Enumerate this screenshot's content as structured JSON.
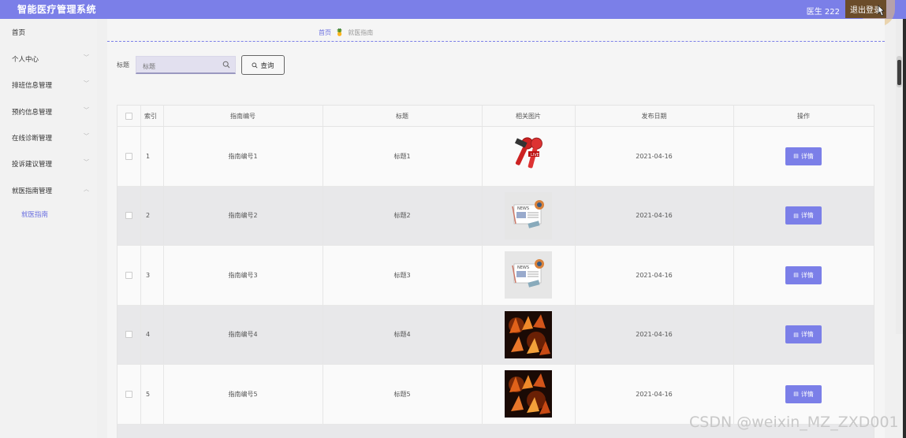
{
  "header": {
    "title": "智能医疗管理系统",
    "user": "医生 222",
    "logout": "退出登录"
  },
  "sidebar": {
    "items": [
      {
        "label": "首页"
      },
      {
        "label": "个人中心"
      },
      {
        "label": "排班信息管理"
      },
      {
        "label": "预约信息管理"
      },
      {
        "label": "在线诊断管理"
      },
      {
        "label": "投诉建议管理"
      },
      {
        "label": "就医指南管理"
      }
    ],
    "submenu": {
      "label": "就医指南"
    }
  },
  "breadcrumb": {
    "home": "首页",
    "current": "就医指南"
  },
  "search": {
    "label": "标题",
    "placeholder": "标题",
    "button": "查询"
  },
  "table": {
    "columns": [
      "索引",
      "指南编号",
      "标题",
      "相关图片",
      "发布日期",
      "操作"
    ],
    "rows": [
      {
        "index": "1",
        "code": "指南编号1",
        "title": "标题1",
        "image": "microphone-image",
        "date": "2021-04-16",
        "action": "详情"
      },
      {
        "index": "2",
        "code": "指南编号2",
        "title": "标题2",
        "image": "news-image",
        "date": "2021-04-16",
        "action": "详情"
      },
      {
        "index": "3",
        "code": "指南编号3",
        "title": "标题3",
        "image": "news-image",
        "date": "2021-04-16",
        "action": "详情"
      },
      {
        "index": "4",
        "code": "指南编号4",
        "title": "标题4",
        "image": "fire-text-image",
        "date": "2021-04-16",
        "action": "详情"
      },
      {
        "index": "5",
        "code": "指南编号5",
        "title": "标题5",
        "image": "fire-text-image",
        "date": "2021-04-16",
        "action": "详情"
      }
    ]
  },
  "watermark": "CSDN @weixin_MZ_ZXD001",
  "colors": {
    "accent": "#7b7fe8",
    "logout_bg": "#6b4c2a"
  }
}
